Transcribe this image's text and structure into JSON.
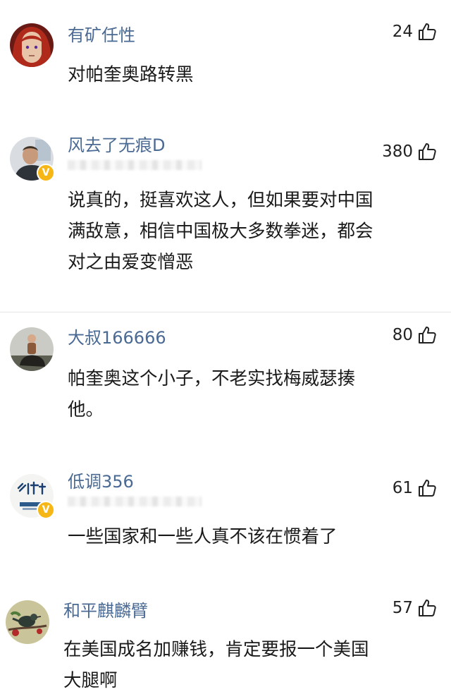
{
  "comments": [
    {
      "username": "有矿任性",
      "likes": "24",
      "verified": false,
      "subline_blurred": false,
      "text": "对帕奎奥路转黑",
      "avatar": "red-hair-anime-avatar"
    },
    {
      "username": "风去了无痕D",
      "likes": "380",
      "verified": true,
      "subline_blurred": true,
      "text": "说真的，挺喜欢这人，但如果要对中国\n满敌意，相信中国极大多数拳迷，都会\n对之由爱变憎恶",
      "avatar": "man-photo-avatar"
    },
    {
      "username": "大叔166666",
      "likes": "80",
      "verified": false,
      "subline_blurred": false,
      "text": "帕奎奥这个小子，不老实找梅威瑟揍\n他。",
      "avatar": "rider-photo-avatar"
    },
    {
      "username": "低调356",
      "likes": "61",
      "verified": true,
      "subline_blurred": true,
      "text": "一些国家和一些人真不该在惯着了",
      "avatar": "calligraphy-logo-avatar"
    },
    {
      "username": "和平麒麟臂",
      "likes": "57",
      "verified": false,
      "subline_blurred": false,
      "text": "在美国成名加赚钱，肯定要报一个美国\n大腿啊",
      "avatar": "bird-on-branch-avatar"
    }
  ],
  "colors": {
    "username": "#4a6a94",
    "text": "#1a1a1a",
    "verified_badge": "#f6b716"
  }
}
